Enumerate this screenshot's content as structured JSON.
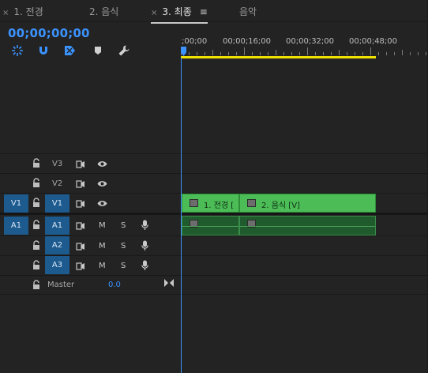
{
  "tabs": [
    {
      "close": "×",
      "label": "1. 전경"
    },
    {
      "close": "",
      "label": "2. 음식"
    },
    {
      "close": "×",
      "label": "3. 최종",
      "menu": "≡"
    },
    {
      "close": "",
      "label": "음악"
    }
  ],
  "timecode": "00;00;00;00",
  "ruler": {
    "labels": [
      ";00;00",
      "00;00;16;00",
      "00;00;32;00",
      "00;00;48;00"
    ]
  },
  "tracks": {
    "video": [
      {
        "name": "V3",
        "source": ""
      },
      {
        "name": "V2",
        "source": ""
      },
      {
        "name": "V1",
        "source": "V1"
      }
    ],
    "audio": [
      {
        "name": "A1",
        "source": "A1",
        "mute": "M",
        "solo": "S"
      },
      {
        "name": "A2",
        "source": "",
        "mute": "M",
        "solo": "S"
      },
      {
        "name": "A3",
        "source": "",
        "mute": "M",
        "solo": "S"
      }
    ],
    "master": {
      "label": "Master",
      "value": "0.0"
    }
  },
  "clips": [
    {
      "label": "1. 전경 ["
    },
    {
      "label": "2. 음식 [V]"
    }
  ],
  "colors": {
    "accent": "#3b93ff",
    "video_clip": "#4cbc57",
    "audio_clip": "#1f5b2c",
    "work_area": "#f0e000",
    "track_target": "#1d5a8e"
  }
}
